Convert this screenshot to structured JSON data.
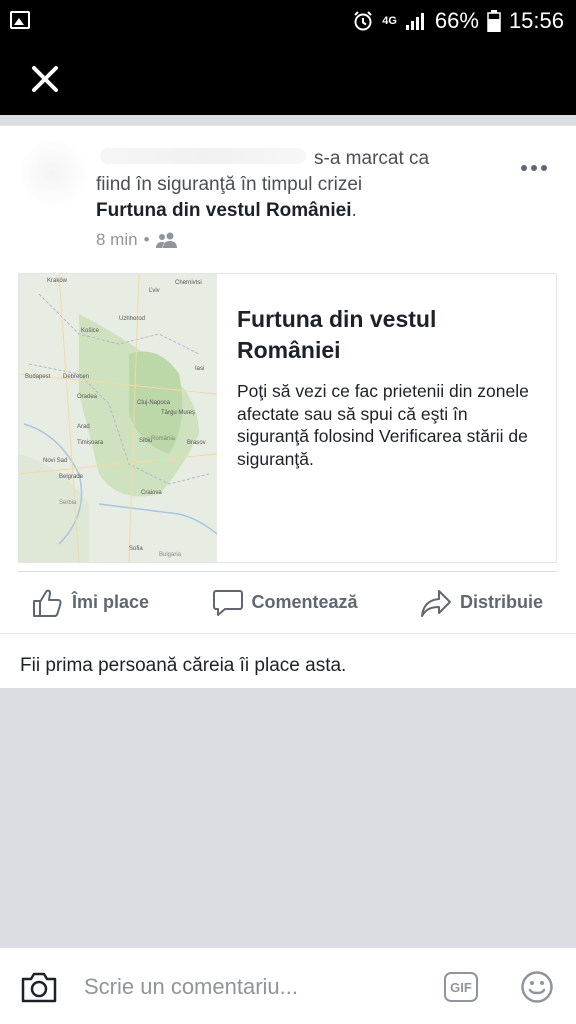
{
  "status_bar": {
    "network": "4G",
    "battery": "66%",
    "time": "15:56",
    "icons": [
      "gallery-icon",
      "alarm-icon",
      "signal-icon",
      "battery-icon"
    ]
  },
  "header": {
    "close_icon": "close-icon"
  },
  "post": {
    "action_text": "s-a marcat ca",
    "line2": "fiind în siguranţă în timpul crizei",
    "crisis_name": "Furtuna din vestul României",
    "period": ".",
    "time_ago": "8 min",
    "separator": "•",
    "audience_icon": "friends-icon",
    "more_icon": "more-dots-icon"
  },
  "attachment": {
    "title": "Furtuna din vestul României",
    "description": "Poţi să vezi ce fac prietenii din zonele afectate sau să spui că eşti în siguranţă folosind Verificarea stării de siguranţă.",
    "map_labels": [
      "Kraków",
      "Ľviv",
      "Košice",
      "Uzhhorod",
      "Budapest",
      "Debrecen",
      "Oradea",
      "Cluj-Napoca",
      "Târgu Mureș",
      "Arad",
      "Timișoara",
      "Sibiu",
      "România",
      "Brașov",
      "Novi Sad",
      "Belgrade",
      "Craiova",
      "Serbia",
      "Sofia",
      "Bulgaria",
      "Chernivtsi",
      "Iasi"
    ]
  },
  "actions": {
    "like": "Îmi place",
    "comment": "Comentează",
    "share": "Distribuie"
  },
  "likes_summary": "Fii prima persoană căreia îi place asta.",
  "composer": {
    "placeholder": "Scrie un comentariu...",
    "gif_label": "GIF"
  },
  "colors": {
    "text_primary": "#1d2129",
    "text_secondary": "#90949c",
    "action_gray": "#606770",
    "background": "#dadde1"
  }
}
